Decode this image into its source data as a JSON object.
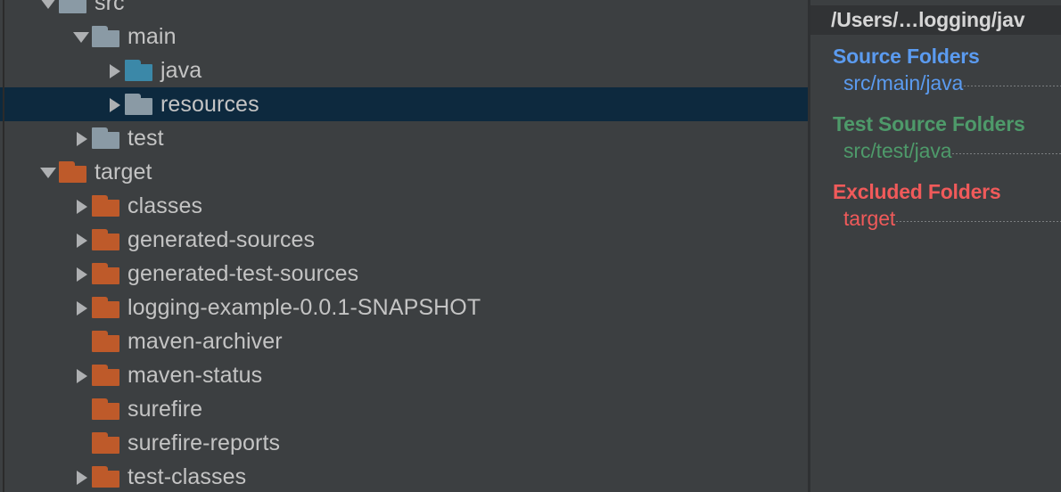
{
  "tree": {
    "rows": [
      {
        "label": "src",
        "indent": 0,
        "twisty": "expanded",
        "folder": "gray",
        "selected": false
      },
      {
        "label": "main",
        "indent": 1,
        "twisty": "expanded",
        "folder": "gray",
        "selected": false
      },
      {
        "label": "java",
        "indent": 2,
        "twisty": "collapsed",
        "folder": "blue",
        "selected": false
      },
      {
        "label": "resources",
        "indent": 2,
        "twisty": "collapsed",
        "folder": "gray",
        "selected": true
      },
      {
        "label": "test",
        "indent": 1,
        "twisty": "collapsed",
        "folder": "gray",
        "selected": false
      },
      {
        "label": "target",
        "indent": 0,
        "twisty": "expanded",
        "folder": "orange",
        "selected": false
      },
      {
        "label": "classes",
        "indent": 1,
        "twisty": "collapsed",
        "folder": "orange",
        "selected": false
      },
      {
        "label": "generated-sources",
        "indent": 1,
        "twisty": "collapsed",
        "folder": "orange",
        "selected": false
      },
      {
        "label": "generated-test-sources",
        "indent": 1,
        "twisty": "collapsed",
        "folder": "orange",
        "selected": false
      },
      {
        "label": "logging-example-0.0.1-SNAPSHOT",
        "indent": 1,
        "twisty": "collapsed",
        "folder": "orange",
        "selected": false
      },
      {
        "label": "maven-archiver",
        "indent": 1,
        "twisty": "none",
        "folder": "orange",
        "selected": false
      },
      {
        "label": "maven-status",
        "indent": 1,
        "twisty": "collapsed",
        "folder": "orange",
        "selected": false
      },
      {
        "label": "surefire",
        "indent": 1,
        "twisty": "none",
        "folder": "orange",
        "selected": false
      },
      {
        "label": "surefire-reports",
        "indent": 1,
        "twisty": "none",
        "folder": "orange",
        "selected": false
      },
      {
        "label": "test-classes",
        "indent": 1,
        "twisty": "collapsed",
        "folder": "orange",
        "selected": false
      }
    ]
  },
  "info": {
    "header": "/Users/…logging/jav",
    "sections": [
      {
        "title": "Source Folders",
        "color_class": "src",
        "accent": "#5b9bf0",
        "items": [
          "src/main/java"
        ]
      },
      {
        "title": "Test Source Folders",
        "color_class": "test",
        "accent": "#4e9a6a",
        "items": [
          "src/test/java"
        ]
      },
      {
        "title": "Excluded Folders",
        "color_class": "excl",
        "accent": "#f05a5a",
        "items": [
          "target"
        ]
      }
    ]
  },
  "theme": {
    "background": "#3c3f41",
    "selection": "#0d293e",
    "text": "#c4c4c4",
    "folder_gray": "#8a9aa5",
    "folder_blue": "#3b88a8",
    "folder_orange": "#be5a2a"
  }
}
